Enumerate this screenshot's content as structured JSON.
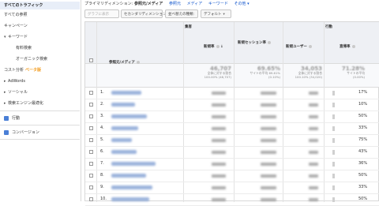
{
  "sidebar": {
    "items": [
      {
        "label": "すべてのトラフィック",
        "level": 0,
        "active": true
      },
      {
        "label": "すべての参照",
        "level": 0
      },
      {
        "label": "キャンペーン",
        "level": 0
      },
      {
        "label": "キーワード",
        "level": 0,
        "caret": "▾"
      },
      {
        "label": "有料検索",
        "level": 2
      },
      {
        "label": "オーガニック検索",
        "level": 2
      },
      {
        "label": "コスト分析",
        "level": 0,
        "badge": "ベータ版"
      },
      {
        "label": "AdWords",
        "level": 0,
        "caret": "▸"
      },
      {
        "label": "ソーシャル",
        "level": 0,
        "caret": "▸"
      },
      {
        "label": "検索エンジン最適化",
        "level": 0,
        "caret": "▸"
      }
    ],
    "sections": [
      {
        "label": "行動",
        "icon": "behavior-icon",
        "color": "#4a7fd6"
      },
      {
        "label": "コンバージョン",
        "icon": "conversion-icon",
        "color": "#4a7fd6"
      }
    ]
  },
  "topbar": {
    "prefix": "プライマリディメンション:",
    "current": "参照元/メディア",
    "links": [
      "参照元",
      "メディア",
      "キーワード",
      "その他 ▾"
    ]
  },
  "toolbar": {
    "plot_rows": "グラフに表示",
    "secondary": "セカンダリディメンション",
    "sort": "並べ替えの種類:",
    "sort_value": "デフォルト"
  },
  "table": {
    "groups": [
      "集客",
      "行動"
    ],
    "columns": [
      "参照元/メディア",
      "新規率",
      "新規セッション率",
      "新規ユーザー",
      "直帰率"
    ],
    "rows": [
      {
        "num": "1.",
        "pct": "17%"
      },
      {
        "num": "2.",
        "pct": "10%"
      },
      {
        "num": "3.",
        "pct": "50%"
      },
      {
        "num": "4.",
        "pct": "33%"
      },
      {
        "num": "5.",
        "pct": "75%"
      },
      {
        "num": "6.",
        "pct": "43%"
      },
      {
        "num": "7.",
        "pct": "36%"
      },
      {
        "num": "8.",
        "pct": "50%"
      },
      {
        "num": "9.",
        "pct": "33%"
      },
      {
        "num": "10.",
        "pct": "50%"
      }
    ]
  },
  "colors": {
    "accent": "#1155cc",
    "orange": "#f29b1d",
    "header_bg": "#eef0f4"
  }
}
